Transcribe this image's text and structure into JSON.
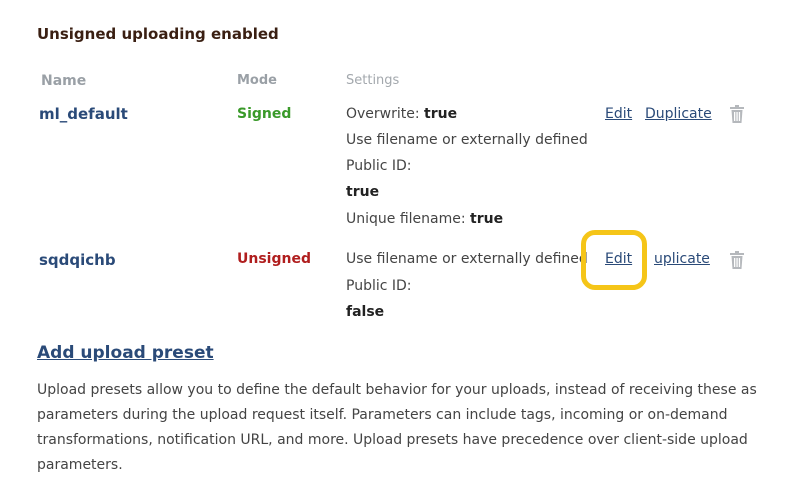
{
  "section": {
    "title": "Unsigned uploading enabled"
  },
  "table": {
    "headers": {
      "name": "Name",
      "mode": "Mode",
      "settings": "Settings"
    },
    "rows": [
      {
        "name": "ml_default",
        "mode": "Signed",
        "settings": [
          {
            "label": "Overwrite:",
            "value": "true"
          },
          {
            "label": "Use filename or externally defined",
            "value": ""
          },
          {
            "label": "Public ID:",
            "value": ""
          },
          {
            "label": "",
            "value": "true"
          },
          {
            "label": "Unique filename:",
            "value": "true"
          }
        ],
        "edit_label": "Edit",
        "duplicate_label": "Duplicate"
      },
      {
        "name": "sqdqichb",
        "mode": "Unsigned",
        "settings": [
          {
            "label": "Use filename or externally defined",
            "value": ""
          },
          {
            "label": "Public ID:",
            "value": ""
          },
          {
            "label": "",
            "value": "false"
          }
        ],
        "edit_label": "Edit",
        "duplicate_label": "uplicate"
      }
    ]
  },
  "add_preset": {
    "label": "Add upload preset"
  },
  "description": "Upload presets allow you to define the default behavior for your uploads, instead of receiving these as parameters during the upload request itself. Parameters can include tags, incoming or on-demand transformations, notification URL, and more. Upload presets have precedence over client-side upload parameters.",
  "colors": {
    "highlight": "#f5c518",
    "link": "#2a4a78",
    "signed": "#3a9a2a",
    "unsigned": "#b01e1e"
  },
  "icons": {
    "delete": "trash-icon"
  }
}
